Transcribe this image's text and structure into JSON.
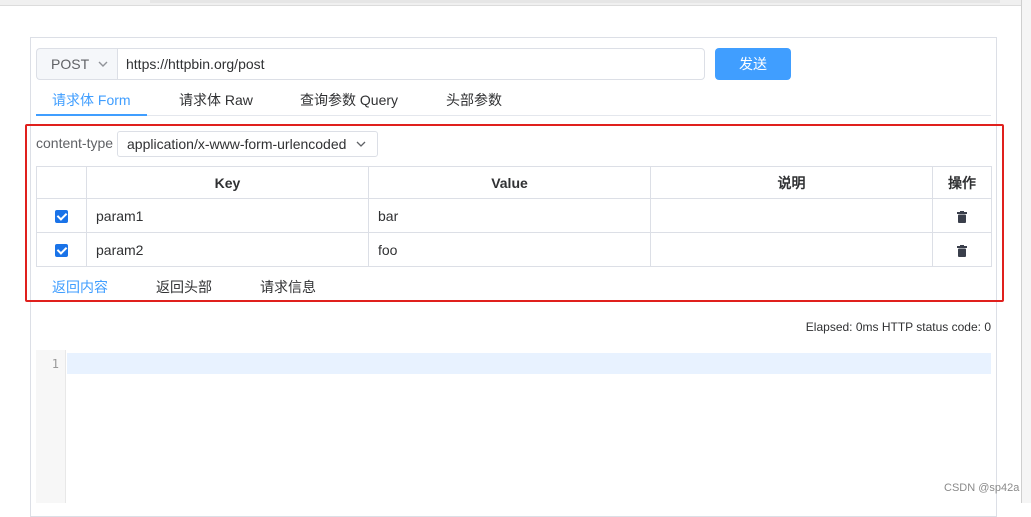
{
  "request": {
    "method": "POST",
    "url": "https://httpbin.org/post",
    "send_label": "发送"
  },
  "tabs": [
    {
      "label": "请求体 Form",
      "active": true
    },
    {
      "label": "请求体 Raw",
      "active": false
    },
    {
      "label": "查询参数 Query",
      "active": false
    },
    {
      "label": "头部参数",
      "active": false
    }
  ],
  "content_type": {
    "label": "content-type",
    "value": "application/x-www-form-urlencoded"
  },
  "params_table": {
    "headers": [
      "Key",
      "Value",
      "说明",
      "操作"
    ],
    "rows": [
      {
        "checked": true,
        "key": "param1",
        "value": "bar",
        "desc": ""
      },
      {
        "checked": true,
        "key": "param2",
        "value": "foo",
        "desc": ""
      }
    ]
  },
  "response_tabs": [
    {
      "label": "返回内容",
      "active": true
    },
    {
      "label": "返回头部",
      "active": false
    },
    {
      "label": "请求信息",
      "active": false
    }
  ],
  "status_text": "Elapsed: 0ms HTTP status code: 0",
  "editor": {
    "line_number": "1"
  },
  "watermark": "CSDN @sp42a",
  "colors": {
    "accent": "#409eff",
    "highlight_box": "#e0201d",
    "checkbox": "#1a73e8"
  },
  "icons": {
    "method_dropdown": "chevron-down-icon",
    "content_type_dropdown": "chevron-down-icon",
    "row_delete": "trash-icon",
    "row_check": "checkbox-icon"
  }
}
